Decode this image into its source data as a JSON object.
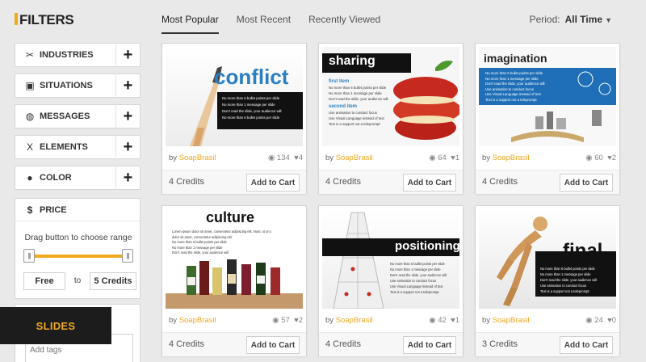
{
  "sidebar": {
    "title": "FILTERS",
    "filters": [
      {
        "label": "INDUSTRIES",
        "icon": "tools-icon"
      },
      {
        "label": "SITUATIONS",
        "icon": "briefcase-icon"
      },
      {
        "label": "MESSAGES",
        "icon": "speech-bubble-icon"
      },
      {
        "label": "ELEMENTS",
        "icon": "dna-icon"
      },
      {
        "label": "COLOR",
        "icon": "drop-icon"
      }
    ],
    "price": {
      "label": "PRICE",
      "icon": "dollar-icon",
      "hint": "Drag button to choose range",
      "from": "Free",
      "to_label": "to",
      "to": "5 Credits"
    },
    "tags_placeholder": "Add tags",
    "badge": "SLIDES"
  },
  "tabs": [
    "Most Popular",
    "Most Recent",
    "Recently Viewed"
  ],
  "active_tab": "Most Popular",
  "period": {
    "label": "Period:",
    "value": "All Time"
  },
  "accent_color": "#f1a81d",
  "cards": [
    {
      "title": "conflict",
      "bullets": [
        "No more than 6 bullet points per slide",
        "No more than 1 message per slide",
        "Don't read the slide, your audience will",
        "No more than 6 bullet points per slide"
      ],
      "author": "SoapBrasil",
      "views": "134",
      "likes": "4",
      "credits": "4 Credits",
      "cart": "Add to Cart"
    },
    {
      "title": "sharing",
      "bullets": [
        "first item",
        "No more than 6 bullet points per slide",
        "No more than 1 message per slide",
        "Don't read the slide, your audience will",
        "second item",
        "Use animation to conduct focus",
        "Use Visual Language instead of text",
        "Text is a support not a teleprompt"
      ],
      "author": "SoapBrasil",
      "views": "64",
      "likes": "1",
      "credits": "4 Credits",
      "cart": "Add to Cart"
    },
    {
      "title": "imagination",
      "bullets": [
        "No more than 6 bullet points per slide",
        "No more than 1 message per slide",
        "Don't read the slide, your audience will",
        "Use animation to conduct focus",
        "Use Visual Language instead of text",
        "Text is a support not a teleprompt"
      ],
      "author": "SoapBrasil",
      "views": "60",
      "likes": "2",
      "credits": "4 Credits",
      "cart": "Add to Cart"
    },
    {
      "title": "culture",
      "bullets": [
        "Lorem ipsum dolor sit amet, consectetur adipiscing elit. Nunc ut orci",
        "dolor sit amet, consectetur adipiscing elit.",
        "No more than 6 bullet points per slide",
        "No more than 1 message per slide",
        "Don't read the slide, your audience will"
      ],
      "author": "SoapBrasil",
      "views": "57",
      "likes": "2",
      "credits": "4 Credits",
      "cart": "Add to Cart"
    },
    {
      "title": "positioning",
      "bullets": [
        "No more than 6 bullet points per slide",
        "No more than 1 message per slide",
        "Don't read the slide, your audience will",
        "Use animation to conduct focus",
        "Use Visual Language instead of text",
        "Text is a support not a teleprompt"
      ],
      "author": "SoapBrasil",
      "views": "42",
      "likes": "1",
      "credits": "4 Credits",
      "cart": "Add to Cart"
    },
    {
      "title": "final",
      "bullets": [
        "No more than 6 bullet points per slide",
        "No more than 1 message per slide",
        "Don't read the slide, your audience will",
        "Use animation to conduct focus",
        "Text is a support not a teleprompt"
      ],
      "author": "SoapBrasil",
      "views": "24",
      "likes": "0",
      "credits": "3 Credits",
      "cart": "Add to Cart"
    }
  ],
  "by_label": "by"
}
